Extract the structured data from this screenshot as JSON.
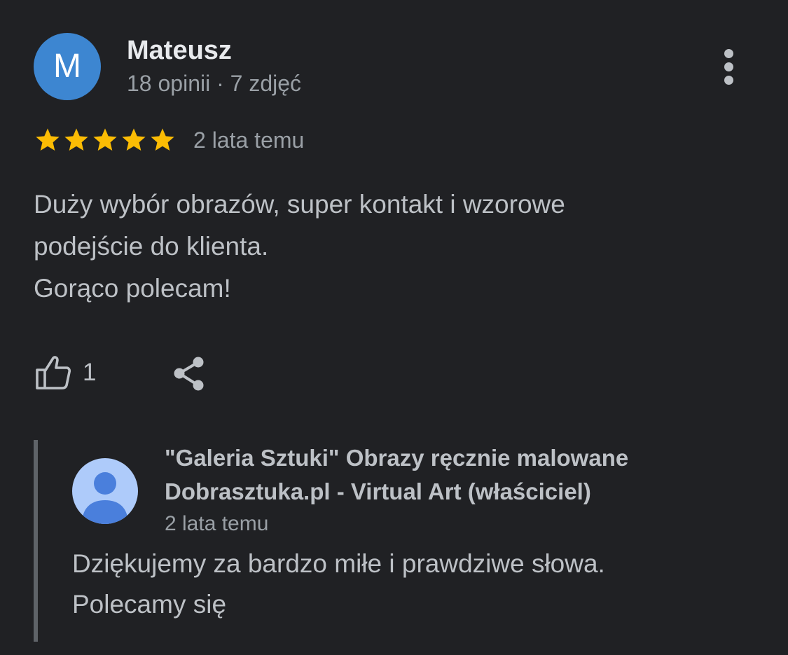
{
  "review": {
    "author": {
      "initial": "M",
      "name": "Mateusz",
      "meta": "18 opinii · 7 zdjęć",
      "avatar_color": "#3d86d1"
    },
    "menu_icon": "more-vert-icon",
    "rating": 5,
    "star_color": "#fbbc04",
    "date": "2 lata temu",
    "text_lines": [
      "Duży wybór obrazów, super kontakt i wzorowe",
      "podejście do klienta.",
      "Gorąco polecam!"
    ],
    "like_icon": "thumbs-up-icon",
    "like_count": "1",
    "share_icon": "share-icon"
  },
  "owner_reply": {
    "avatar_icon": "default-person-avatar",
    "avatar_color": "#aecbfa",
    "name_lines": [
      "\"Galeria Sztuki\" Obrazy ręcznie malowane",
      "Dobrasztuka.pl - Virtual Art (właściciel)"
    ],
    "date": "2 lata temu",
    "text_lines": [
      "Dziękujemy za bardzo miłe i prawdziwe słowa.",
      "Polecamy się"
    ]
  }
}
